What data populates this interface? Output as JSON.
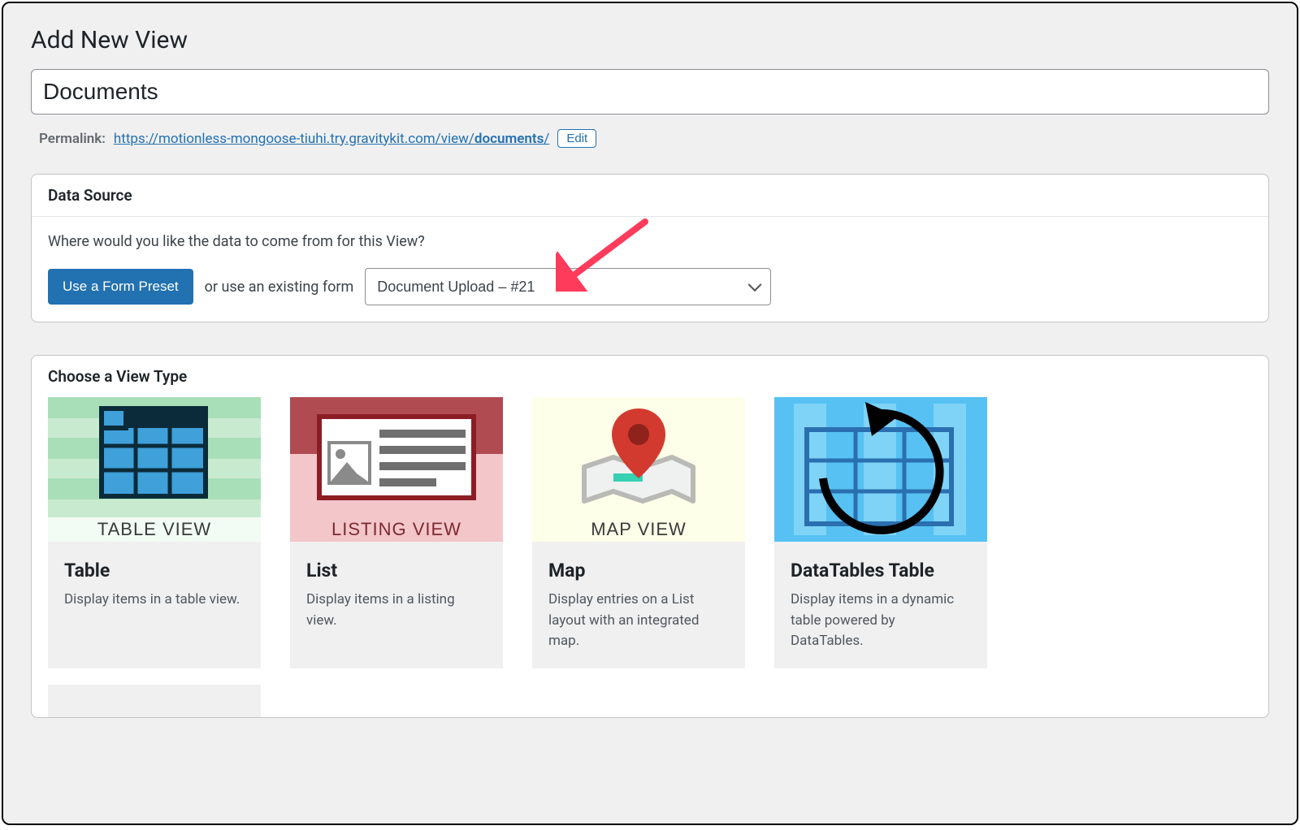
{
  "page": {
    "heading": "Add New View",
    "title_value": "Documents"
  },
  "permalink": {
    "label": "Permalink:",
    "url_prefix": "https://motionless-mongoose-tiuhi.try.gravitykit.com/view/",
    "slug": "documents",
    "trailing": "/",
    "edit_label": "Edit"
  },
  "data_source": {
    "panel_title": "Data Source",
    "prompt": "Where would you like the data to come from for this View?",
    "preset_button": "Use a Form Preset",
    "or_text": "or use an existing form",
    "selected_form": "Document Upload – #21"
  },
  "view_types": {
    "panel_title": "Choose a View Type",
    "cards": [
      {
        "title": "Table",
        "desc": "Display items in a table view.",
        "thumb_label": "TABLE VIEW"
      },
      {
        "title": "List",
        "desc": "Display items in a listing view.",
        "thumb_label": "LISTING VIEW"
      },
      {
        "title": "Map",
        "desc": "Display entries on a List layout with an integrated map.",
        "thumb_label": "MAP VIEW"
      },
      {
        "title": "DataTables Table",
        "desc": "Display items in a dynamic table powered by DataTables.",
        "thumb_label": ""
      }
    ]
  }
}
